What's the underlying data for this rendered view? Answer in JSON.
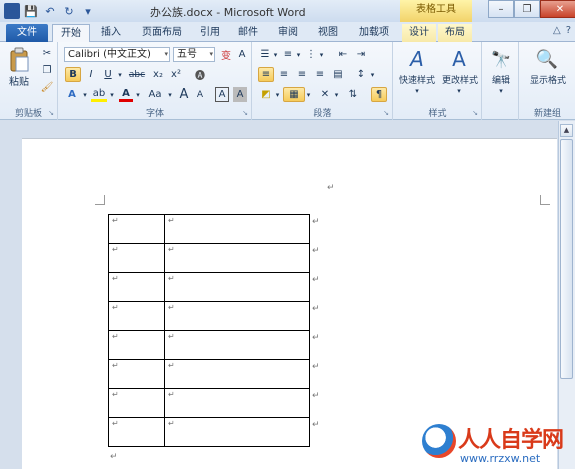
{
  "window": {
    "title": "办公族.docx - Microsoft Word",
    "context_tools_title": "表格工具",
    "minimize": "–",
    "restore": "❐",
    "close": "✕"
  },
  "qat": {
    "app_icon": "W",
    "save": "💾",
    "undo": "↶",
    "redo": "↻",
    "customize": "▾"
  },
  "tabs": {
    "file": "文件",
    "home": "开始",
    "insert": "插入",
    "page_layout": "页面布局",
    "references": "引用",
    "mailings": "邮件",
    "review": "审阅",
    "view": "视图",
    "addins": "加载项",
    "design": "设计",
    "layout": "布局"
  },
  "ribbon_right": {
    "minimize": "△",
    "help": "?"
  },
  "clipboard": {
    "paste": "粘贴",
    "label": "剪贴板"
  },
  "font": {
    "name": "Calibri (中文正文)",
    "size": "五号",
    "bold": "B",
    "italic": "I",
    "underline": "U",
    "strike": "abc",
    "subscript": "x₂",
    "superscript": "x²",
    "grow": "A",
    "shrink": "A",
    "case": "Aa",
    "char_border": "A",
    "label": "字体"
  },
  "paragraph": {
    "label": "段落"
  },
  "styles": {
    "quick": "快速样式",
    "change": "更改样式",
    "label": "样式"
  },
  "editing": {
    "edit": "编辑"
  },
  "newgroup": {
    "show_format": "显示格式",
    "label": "新建组"
  },
  "document": {
    "mark": "↵",
    "table_rows": 8
  },
  "watermark": {
    "brand": "人人自学网",
    "url": "www.rrzxw.net"
  }
}
